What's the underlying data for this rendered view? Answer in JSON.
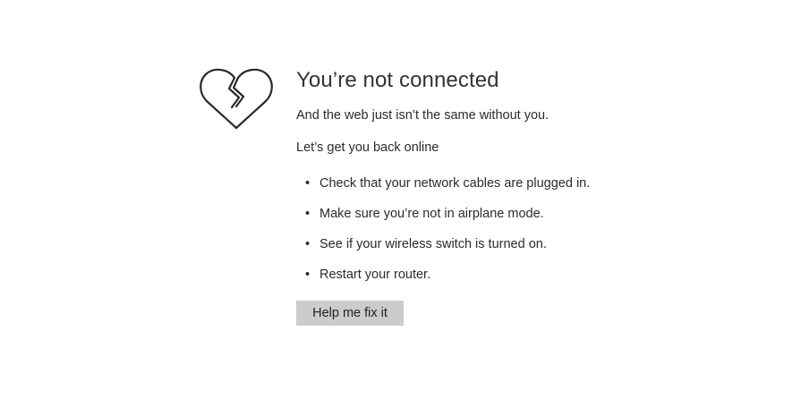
{
  "error": {
    "title": "You’re not connected",
    "subtitle": "And the web just isn’t the same without you.",
    "lead": "Let’s get you back online",
    "tips": [
      "Check that your network cables are plugged in.",
      "Make sure you’re not in airplane mode.",
      "See if your wireless switch is turned on.",
      "Restart your router."
    ],
    "bullet": "•",
    "button_label": "Help me fix it"
  },
  "icon": {
    "name": "broken-heart-icon",
    "stroke_color": "#2b2b2b"
  },
  "colors": {
    "background": "#ffffff",
    "text": "#2b2b2b",
    "button_bg": "#cccccc"
  }
}
